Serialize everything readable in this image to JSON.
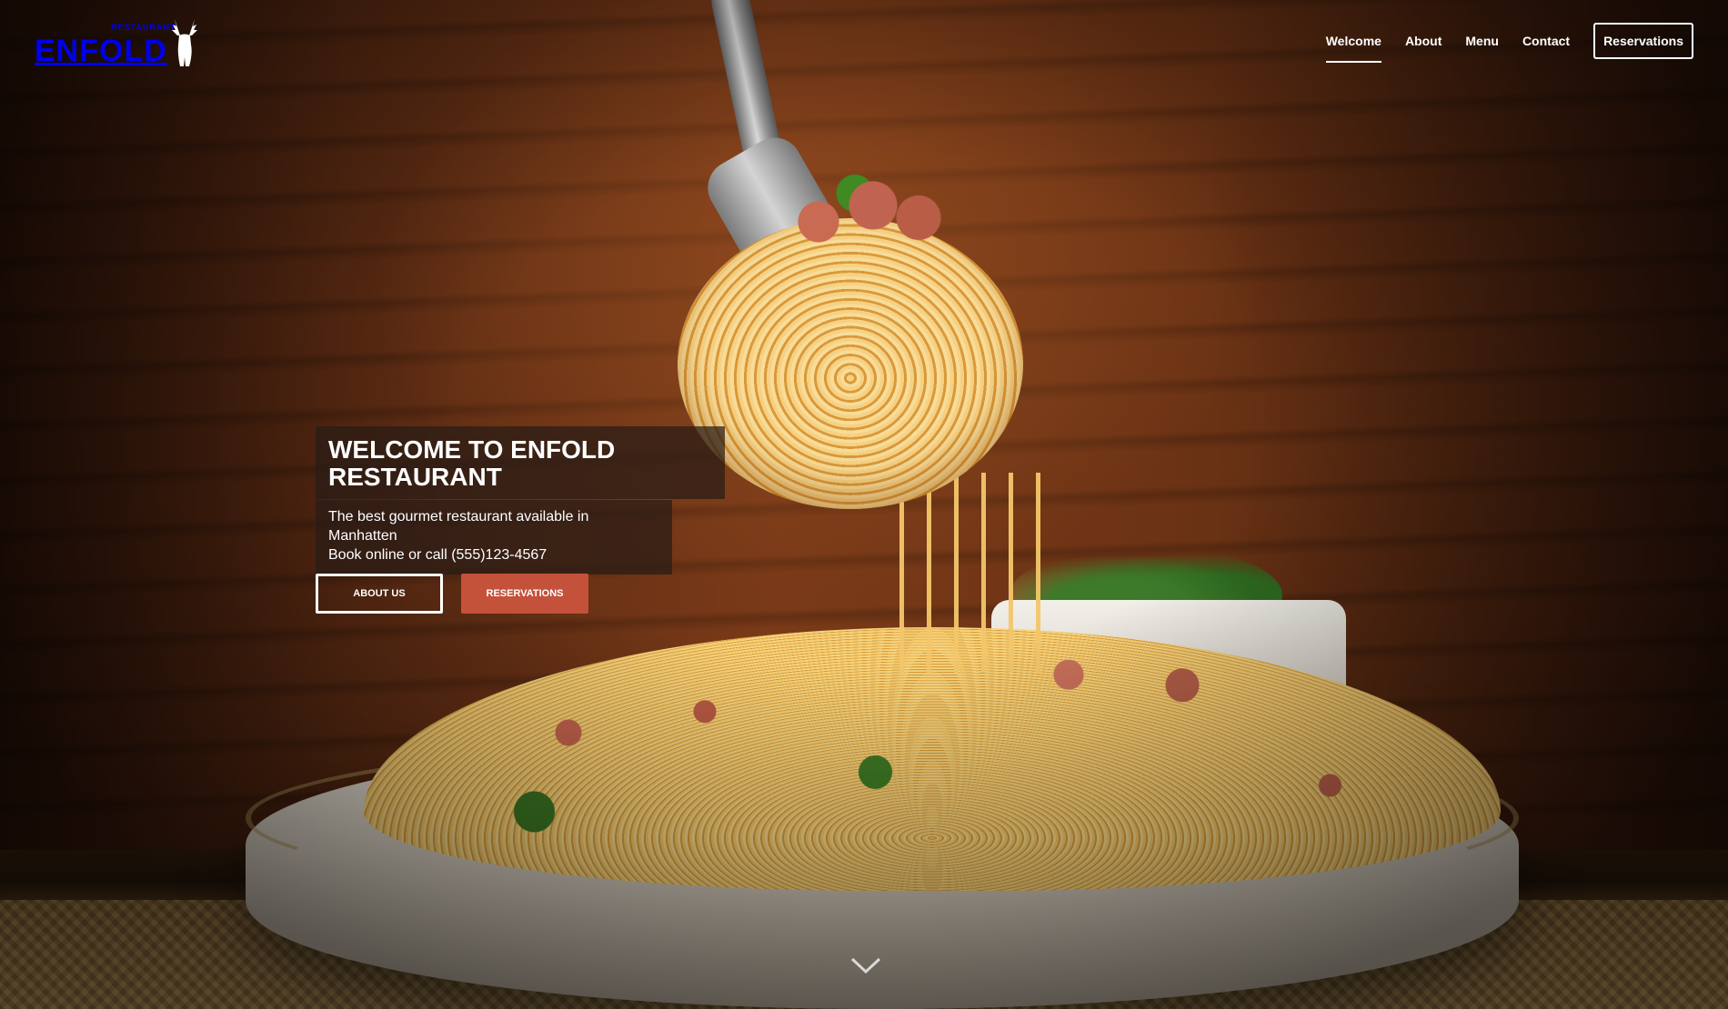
{
  "brand": {
    "small_text": "RESTAURANT",
    "name": "ENFOLD",
    "logo_icon": "deer-icon"
  },
  "nav": {
    "items": [
      {
        "label": "Welcome",
        "active": true
      },
      {
        "label": "About",
        "active": false
      },
      {
        "label": "Menu",
        "active": false
      },
      {
        "label": "Contact",
        "active": false
      }
    ],
    "reservations_label": "Reservations"
  },
  "hero": {
    "title": "WELCOME TO ENFOLD RESTAURANT",
    "subtitle_line1": "The best gourmet restaurant available in Manhatten",
    "subtitle_line2": "Book online or call (555)123-4567",
    "buttons": {
      "about_label": "ABOUT US",
      "reservations_label": "RESERVATIONS"
    },
    "scroll_icon": "chevron-down-icon"
  },
  "colors": {
    "accent": "#c4513a",
    "text": "#ffffff",
    "caption_bg": "#281c16"
  }
}
